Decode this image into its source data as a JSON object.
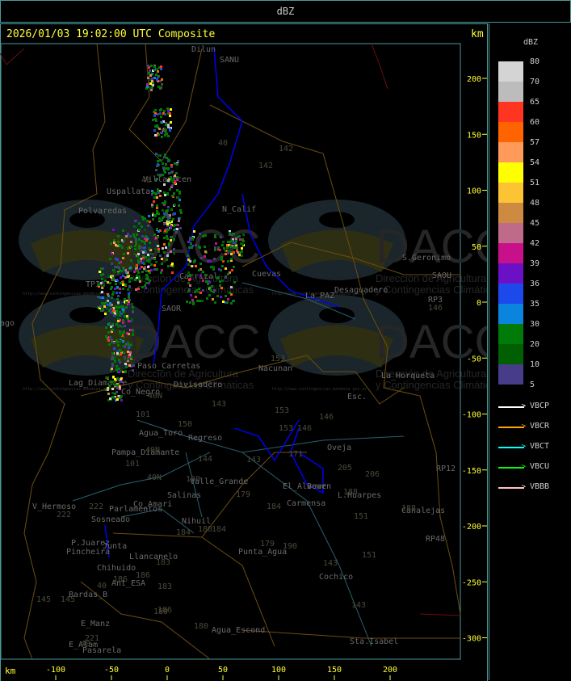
{
  "header": {
    "title": "dBZ"
  },
  "map": {
    "title": "2026/01/03 19:02:00 UTC Composite",
    "unit_label": "km",
    "x_ticks": [
      -100,
      -50,
      0,
      50,
      100,
      150,
      200
    ],
    "y_ticks": [
      200,
      150,
      100,
      50,
      0,
      -50,
      -100,
      -150,
      -200,
      -250,
      -300
    ],
    "places": [
      "Uspallata",
      "Polvaredas",
      "Villavicen",
      "N_Calif",
      "Carrizal",
      "Cuevas",
      "La_PAZ",
      "Desaguadero",
      "S.Geronimo",
      "SAOU",
      "Nacunan",
      "La_Horqueta",
      "Divisadero",
      "Paso_Carretas",
      "Lag_Diamante",
      "Co_Negro",
      "Esc.",
      "Agua_Toro",
      "Regreso",
      "Pampa_Diamante",
      "Valle_Grande",
      "Salinas",
      "Co_Amari",
      "Parlamentos",
      "Sosneado",
      "Nihuil",
      "V_Hermoso",
      "Junta",
      "P.Juarez",
      "Pincheira",
      "Llancanelo",
      "Chihuido",
      "Ant_ESA",
      "Bardas_B",
      "E_Manz",
      "E_Alam",
      "Pasarela",
      "Punta_Agua",
      "Agua_Escond",
      "Sta.Isabel",
      "Cochico",
      "Carmensa",
      "L.Huarpes",
      "Canalejas",
      "Oveja",
      "El_Alvear",
      "Bowen",
      "Dilun",
      "SANU",
      "ago",
      "RP3",
      "RP12",
      "RP48",
      "TPIO",
      "SAOR"
    ],
    "routes": [
      "40",
      "142",
      "142",
      "40",
      "153",
      "153",
      "153",
      "146",
      "146",
      "143",
      "150",
      "101",
      "40N",
      "40N",
      "40N",
      "101",
      "144",
      "180",
      "179",
      "184",
      "184",
      "180",
      "184",
      "183",
      "183",
      "186",
      "186",
      "180",
      "186",
      "180",
      "179",
      "190",
      "143",
      "143",
      "143",
      "205",
      "206",
      "188",
      "151",
      "151",
      "188",
      "171",
      "222",
      "222",
      "221",
      "145",
      "145",
      "40",
      "40",
      "146"
    ]
  },
  "watermark": {
    "brand": "DACC",
    "line1": "Dirección de Agricultura",
    "line2": "y Contingencias Climáticas",
    "url": "http://www.contingencias.mendoza.gov.ar"
  },
  "legend": {
    "title": "dBZ",
    "levels": [
      {
        "value": "80",
        "color": "#d4d4d4"
      },
      {
        "value": "70",
        "color": "#bcbcbc"
      },
      {
        "value": "65",
        "color": "#ff3522"
      },
      {
        "value": "60",
        "color": "#ff6400"
      },
      {
        "value": "57",
        "color": "#ff9a5a"
      },
      {
        "value": "54",
        "color": "#ffff00"
      },
      {
        "value": "51",
        "color": "#fcc334"
      },
      {
        "value": "48",
        "color": "#cd8a40"
      },
      {
        "value": "45",
        "color": "#bf6a88"
      },
      {
        "value": "42",
        "color": "#c8108a"
      },
      {
        "value": "39",
        "color": "#6c10c8"
      },
      {
        "value": "36",
        "color": "#1c48ec"
      },
      {
        "value": "35",
        "color": "#0a84dc"
      },
      {
        "value": "30",
        "color": "#007a08"
      },
      {
        "value": "20",
        "color": "#005f00"
      },
      {
        "value": "10",
        "color": "#463c8a"
      },
      {
        "value": "5",
        "color": ""
      }
    ],
    "radars": [
      {
        "name": "VBCP",
        "color": "#ffffff"
      },
      {
        "name": "VBCR",
        "color": "#ffa500"
      },
      {
        "name": "VBCT",
        "color": "#00ffff"
      },
      {
        "name": "VBCU",
        "color": "#00ff00"
      },
      {
        "name": "VBBB",
        "color": "#ffc0cb"
      }
    ]
  }
}
